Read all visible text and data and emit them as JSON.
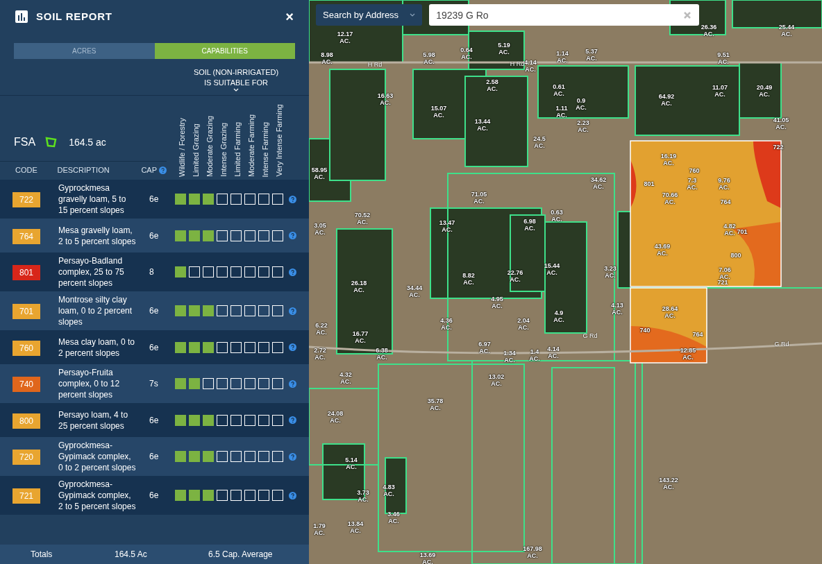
{
  "panel": {
    "title": "SOIL REPORT",
    "close": "×",
    "tabs": [
      {
        "label": "ACRES",
        "selected": false
      },
      {
        "label": "CAPABILITIES",
        "selected": true
      }
    ],
    "suitability_heading": "SOIL (NON-IRRIGATED)\nIS SUITABLE FOR",
    "source": {
      "label": "FSA",
      "acres": "164.5 ac"
    },
    "columns": [
      "CODE",
      "DESCRIPTION",
      "CAP"
    ],
    "uses": [
      "Wildlife / Forestry",
      "Limited Grazing",
      "Moderate Grazing",
      "Intense Grazing",
      "Limited Farming",
      "Moderate Farming",
      "Intense Farming",
      "Very Intense Farming"
    ],
    "rows": [
      {
        "code": "722",
        "color": "#e8a530",
        "description": "Gyprockmesa gravelly loam, 5 to 15 percent slopes",
        "cap": "6e",
        "suitable": [
          true,
          true,
          true,
          false,
          false,
          false,
          false,
          false
        ]
      },
      {
        "code": "764",
        "color": "#e8a530",
        "description": "Mesa gravelly loam, 2 to 5 percent slopes",
        "cap": "6e",
        "suitable": [
          true,
          true,
          true,
          false,
          false,
          false,
          false,
          false
        ]
      },
      {
        "code": "801",
        "color": "#d8261a",
        "description": "Persayo-Badland complex, 25 to 75 percent slopes",
        "cap": "8",
        "suitable": [
          true,
          false,
          false,
          false,
          false,
          false,
          false,
          false
        ]
      },
      {
        "code": "701",
        "color": "#e8a530",
        "description": "Montrose silty clay loam, 0 to 2 percent slopes",
        "cap": "6e",
        "suitable": [
          true,
          true,
          true,
          false,
          false,
          false,
          false,
          false
        ]
      },
      {
        "code": "760",
        "color": "#e8a530",
        "description": "Mesa clay loam, 0 to 2 percent slopes",
        "cap": "6e",
        "suitable": [
          true,
          true,
          true,
          false,
          false,
          false,
          false,
          false
        ]
      },
      {
        "code": "740",
        "color": "#e0661c",
        "description": "Persayo-Fruita complex, 0 to 12 percent slopes",
        "cap": "7s",
        "suitable": [
          true,
          true,
          false,
          false,
          false,
          false,
          false,
          false
        ]
      },
      {
        "code": "800",
        "color": "#e8a530",
        "description": "Persayo loam, 4 to 25 percent slopes",
        "cap": "6e",
        "suitable": [
          true,
          true,
          true,
          false,
          false,
          false,
          false,
          false
        ]
      },
      {
        "code": "720",
        "color": "#e8a530",
        "description": "Gyprockmesa-Gypimack complex, 0 to 2 percent slopes",
        "cap": "6e",
        "suitable": [
          true,
          true,
          true,
          false,
          false,
          false,
          false,
          false
        ]
      },
      {
        "code": "721",
        "color": "#e8a530",
        "description": "Gyprockmesa-Gypimack complex, 2 to 5 percent slopes",
        "cap": "6e",
        "suitable": [
          true,
          true,
          true,
          false,
          false,
          false,
          false,
          false
        ]
      }
    ],
    "totals": {
      "label": "Totals",
      "acres": "164.5 Ac",
      "cap_average": "6.5 Cap. Average"
    }
  },
  "search": {
    "mode": "Search by Address",
    "value": "19239 G Ro"
  },
  "map": {
    "labels": [
      {
        "kind": "parcel",
        "acres": "12.17",
        "unit": "AC."
      },
      {
        "kind": "parcel",
        "acres": "5.98",
        "unit": "AC."
      },
      {
        "kind": "parcel",
        "acres": "0.64",
        "unit": "AC."
      },
      {
        "kind": "parcel",
        "acres": "5.19",
        "unit": "AC."
      },
      {
        "kind": "parcel",
        "acres": "1.14",
        "unit": "AC."
      },
      {
        "kind": "parcel",
        "acres": "5.37",
        "unit": "AC."
      },
      {
        "kind": "parcel",
        "acres": "26.36",
        "unit": "AC."
      },
      {
        "kind": "parcel",
        "acres": "25.44",
        "unit": "AC."
      },
      {
        "kind": "parcel",
        "acres": "8.98",
        "unit": "AC."
      },
      {
        "kind": "parcel",
        "acres": "9.51",
        "unit": "AC."
      },
      {
        "kind": "parcel",
        "acres": "4.14",
        "unit": "AC."
      },
      {
        "kind": "parcel",
        "acres": "2.58",
        "unit": "AC."
      },
      {
        "kind": "parcel",
        "acres": "16.63",
        "unit": "AC."
      },
      {
        "kind": "parcel",
        "acres": "15.07",
        "unit": "AC."
      },
      {
        "kind": "parcel",
        "acres": "13.44",
        "unit": "AC."
      },
      {
        "kind": "parcel",
        "acres": "0.61",
        "unit": "AC."
      },
      {
        "kind": "parcel",
        "acres": "0.9",
        "unit": "AC."
      },
      {
        "kind": "parcel",
        "acres": "1.11",
        "unit": "AC."
      },
      {
        "kind": "parcel",
        "acres": "2.23",
        "unit": "AC."
      },
      {
        "kind": "parcel",
        "acres": "64.92",
        "unit": "AC."
      },
      {
        "kind": "parcel",
        "acres": "11.07",
        "unit": "AC."
      },
      {
        "kind": "parcel",
        "acres": "20.49",
        "unit": "AC."
      },
      {
        "kind": "parcel",
        "acres": "41.05",
        "unit": "AC."
      },
      {
        "kind": "parcel",
        "acres": "24.5",
        "unit": "AC."
      },
      {
        "kind": "parcel",
        "acres": "16.19",
        "unit": "AC."
      },
      {
        "kind": "parcel",
        "acres": "58.95",
        "unit": "AC."
      },
      {
        "kind": "parcel",
        "acres": "71.05",
        "unit": "AC."
      },
      {
        "kind": "parcel",
        "acres": "34.62",
        "unit": "AC."
      },
      {
        "kind": "parcel",
        "acres": "70.52",
        "unit": "AC."
      },
      {
        "kind": "parcel",
        "acres": "13.47",
        "unit": "AC."
      },
      {
        "kind": "parcel",
        "acres": "6.98",
        "unit": "AC."
      },
      {
        "kind": "parcel",
        "acres": "0.63",
        "unit": "AC."
      },
      {
        "kind": "parcel",
        "acres": "43.69",
        "unit": "AC."
      },
      {
        "kind": "parcel",
        "acres": "3.05",
        "unit": "AC."
      },
      {
        "kind": "parcel",
        "acres": "8.82",
        "unit": "AC."
      },
      {
        "kind": "parcel",
        "acres": "22.76",
        "unit": "AC."
      },
      {
        "kind": "parcel",
        "acres": "15.44",
        "unit": "AC."
      },
      {
        "kind": "parcel",
        "acres": "3.23",
        "unit": "AC."
      },
      {
        "kind": "parcel",
        "acres": "26.18",
        "unit": "AC."
      },
      {
        "kind": "parcel",
        "acres": "34.44",
        "unit": "AC."
      },
      {
        "kind": "parcel",
        "acres": "4.95",
        "unit": "AC."
      },
      {
        "kind": "parcel",
        "acres": "4.13",
        "unit": "AC."
      },
      {
        "kind": "parcel",
        "acres": "28.64",
        "unit": "AC."
      },
      {
        "kind": "parcel",
        "acres": "6.22",
        "unit": "AC."
      },
      {
        "kind": "parcel",
        "acres": "16.77",
        "unit": "AC."
      },
      {
        "kind": "parcel",
        "acres": "4.36",
        "unit": "AC."
      },
      {
        "kind": "parcel",
        "acres": "2.04",
        "unit": "AC."
      },
      {
        "kind": "parcel",
        "acres": "4.9",
        "unit": "AC."
      },
      {
        "kind": "parcel",
        "acres": "2.72",
        "unit": "AC."
      },
      {
        "kind": "parcel",
        "acres": "6.38",
        "unit": "AC."
      },
      {
        "kind": "parcel",
        "acres": "6.97",
        "unit": "AC."
      },
      {
        "kind": "parcel",
        "acres": "1.34",
        "unit": "AC."
      },
      {
        "kind": "parcel",
        "acres": "1.4",
        "unit": "AC."
      },
      {
        "kind": "parcel",
        "acres": "4.14",
        "unit": "AC."
      },
      {
        "kind": "parcel",
        "acres": "12.85",
        "unit": "AC."
      },
      {
        "kind": "parcel",
        "acres": "4.32",
        "unit": "AC."
      },
      {
        "kind": "parcel",
        "acres": "13.02",
        "unit": "AC."
      },
      {
        "kind": "parcel",
        "acres": "35.78",
        "unit": "AC."
      },
      {
        "kind": "parcel",
        "acres": "24.08",
        "unit": "AC."
      },
      {
        "kind": "parcel",
        "acres": "5.14",
        "unit": "AC."
      },
      {
        "kind": "parcel",
        "acres": "4.83",
        "unit": "AC."
      },
      {
        "kind": "parcel",
        "acres": "3.73",
        "unit": "AC."
      },
      {
        "kind": "parcel",
        "acres": "3.46",
        "unit": "AC."
      },
      {
        "kind": "parcel",
        "acres": "143.22",
        "unit": "AC."
      },
      {
        "kind": "parcel",
        "acres": "13.84",
        "unit": "AC."
      },
      {
        "kind": "parcel",
        "acres": "1.79",
        "unit": "AC."
      },
      {
        "kind": "parcel",
        "acres": "167.98",
        "unit": "AC."
      },
      {
        "kind": "parcel",
        "acres": "13.69",
        "unit": "AC."
      },
      {
        "kind": "parcel",
        "acres": "70.66",
        "unit": "AC."
      },
      {
        "kind": "parcel",
        "acres": "7.3",
        "unit": "AC."
      },
      {
        "kind": "parcel",
        "acres": "9.76",
        "unit": "AC."
      },
      {
        "kind": "parcel",
        "acres": "4.82",
        "unit": "AC."
      },
      {
        "kind": "parcel",
        "acres": "7.06",
        "unit": "AC."
      },
      {
        "kind": "soil",
        "text": "722"
      },
      {
        "kind": "soil",
        "text": "801"
      },
      {
        "kind": "soil",
        "text": "760"
      },
      {
        "kind": "soil",
        "text": "764"
      },
      {
        "kind": "soil",
        "text": "701"
      },
      {
        "kind": "soil",
        "text": "800"
      },
      {
        "kind": "soil",
        "text": "721"
      },
      {
        "kind": "soil",
        "text": "740"
      },
      {
        "kind": "soil",
        "text": "764"
      },
      {
        "kind": "road",
        "text": "H Rd"
      },
      {
        "kind": "road",
        "text": "H Rd"
      },
      {
        "kind": "road",
        "text": "G Rd"
      },
      {
        "kind": "road",
        "text": "G Rd"
      }
    ]
  }
}
